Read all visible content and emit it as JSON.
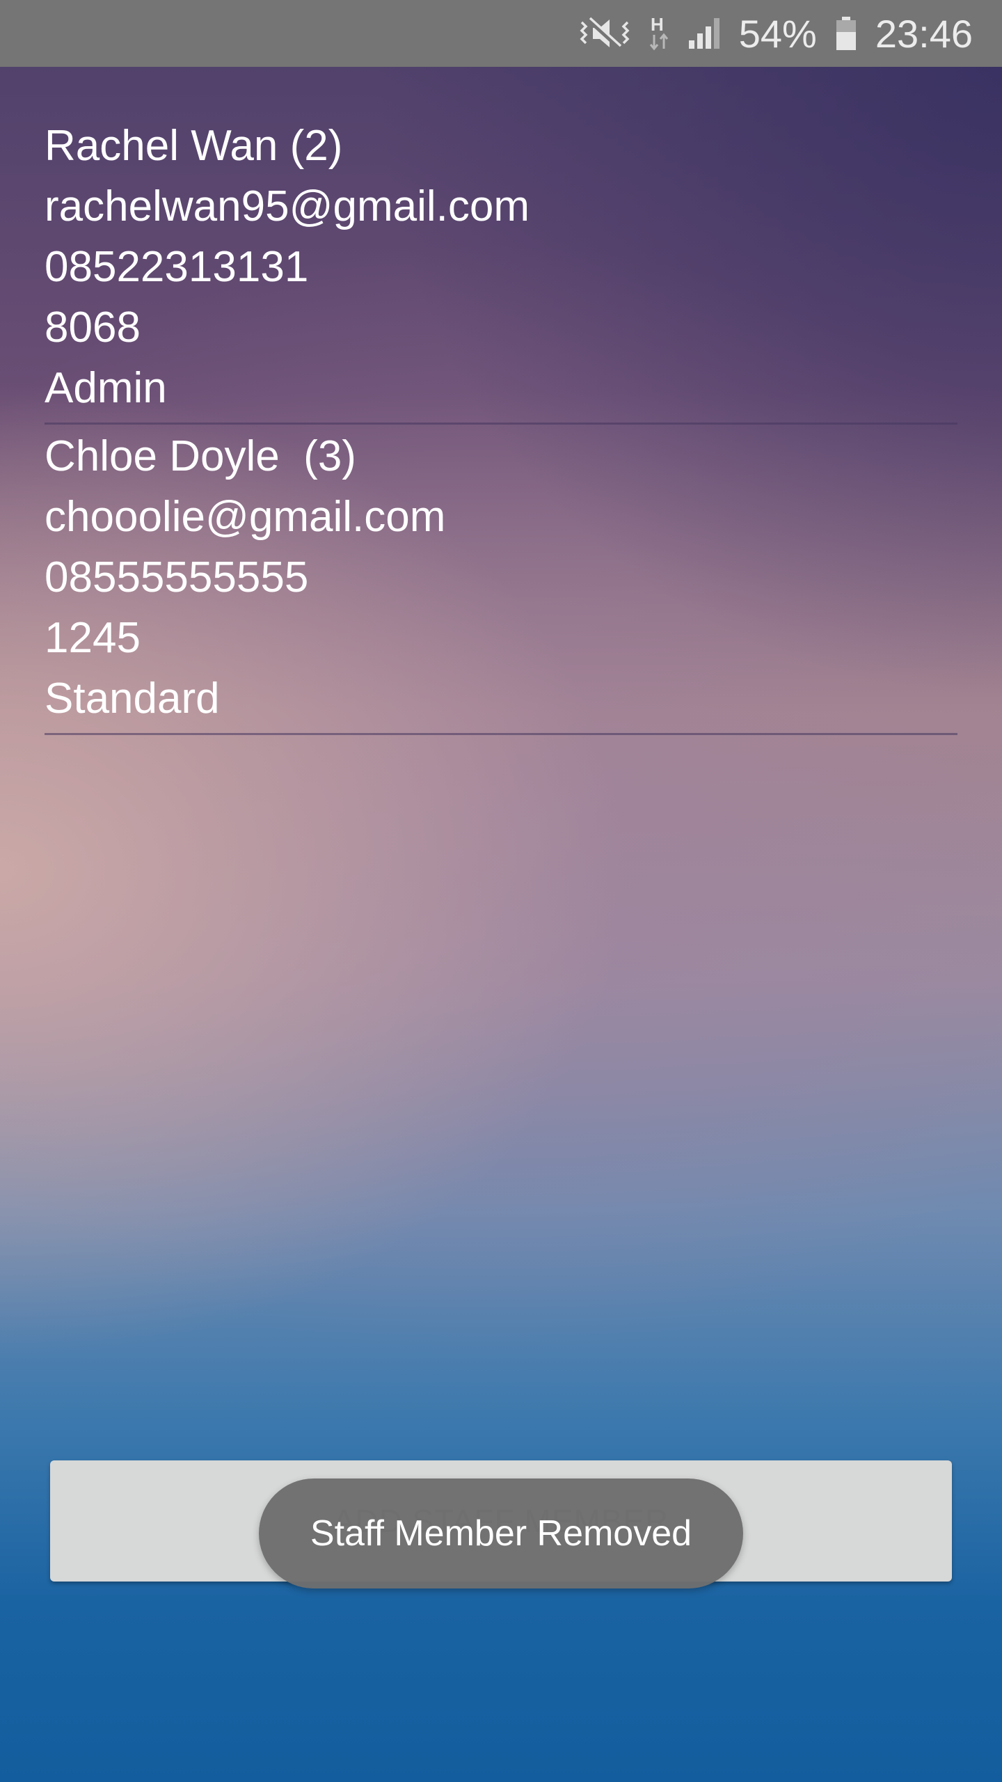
{
  "status_bar": {
    "battery_percent": "54%",
    "time": "23:46",
    "network_type": "H",
    "icons": [
      "mute-vibrate-icon",
      "data-transfer-icon",
      "signal-icon",
      "battery-icon"
    ]
  },
  "staff": [
    {
      "name": "Rachel Wan (2)",
      "email": "rachelwan95@gmail.com",
      "phone": "08522313131",
      "pin": "8068",
      "role": "Admin"
    },
    {
      "name": "Chloe Doyle  (3)",
      "email": "chooolie@gmail.com",
      "phone": "08555555555",
      "pin": "1245",
      "role": "Standard"
    }
  ],
  "add_button": {
    "label": "ADD STAFF MEMBER"
  },
  "toast": {
    "message": "Staff Member Removed"
  },
  "colors": {
    "status_bar": "#757575",
    "button": "#d7d8d8",
    "toast": "#6e6e6e"
  }
}
